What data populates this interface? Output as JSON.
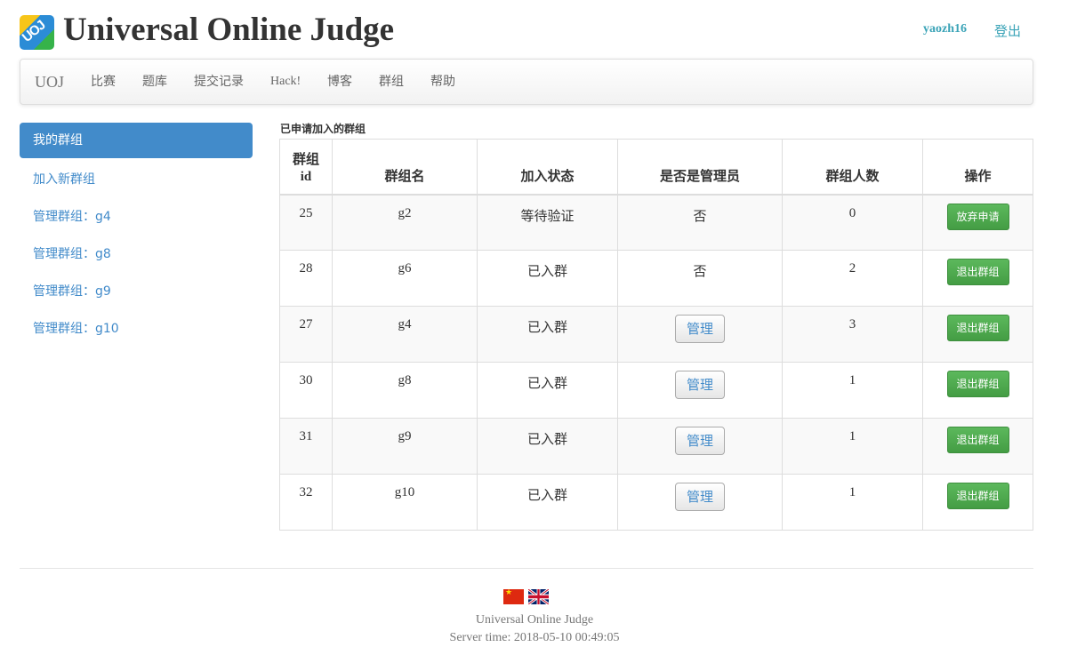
{
  "header": {
    "title": "Universal Online Judge",
    "logo_text": "UOJ",
    "username": "yaozh16",
    "logout_label": "登出"
  },
  "navbar": {
    "brand": "UOJ",
    "items": [
      "比赛",
      "题库",
      "提交记录",
      "Hack!",
      "博客",
      "群组",
      "帮助"
    ]
  },
  "sidebar": {
    "active_label": "我的群组",
    "links": [
      "加入新群组",
      "管理群组：g4",
      "管理群组：g8",
      "管理群组：g9",
      "管理群组：g10"
    ]
  },
  "main": {
    "caption": "已申请加入的群组",
    "columns": [
      "群组id",
      "群组名",
      "加入状态",
      "是否是管理员",
      "群组人数",
      "操作"
    ],
    "rows": [
      {
        "id": "25",
        "name": "g2",
        "status": "等待验证",
        "admin": "否",
        "is_admin": false,
        "members": "0",
        "action": "放弃申请"
      },
      {
        "id": "28",
        "name": "g6",
        "status": "已入群",
        "admin": "否",
        "is_admin": false,
        "members": "2",
        "action": "退出群组"
      },
      {
        "id": "27",
        "name": "g4",
        "status": "已入群",
        "admin": "管理",
        "is_admin": true,
        "members": "3",
        "action": "退出群组"
      },
      {
        "id": "30",
        "name": "g8",
        "status": "已入群",
        "admin": "管理",
        "is_admin": true,
        "members": "1",
        "action": "退出群组"
      },
      {
        "id": "31",
        "name": "g9",
        "status": "已入群",
        "admin": "管理",
        "is_admin": true,
        "members": "1",
        "action": "退出群组"
      },
      {
        "id": "32",
        "name": "g10",
        "status": "已入群",
        "admin": "管理",
        "is_admin": true,
        "members": "1",
        "action": "退出群组"
      }
    ]
  },
  "footer": {
    "site_name": "Universal Online Judge",
    "server_time": "Server time: 2018-05-10 00:49:05",
    "languages": [
      "cn-flag-icon",
      "uk-flag-icon"
    ]
  },
  "colors": {
    "accent": "#428bca",
    "link": "#3aa3b7",
    "success": "#5cb85c"
  }
}
